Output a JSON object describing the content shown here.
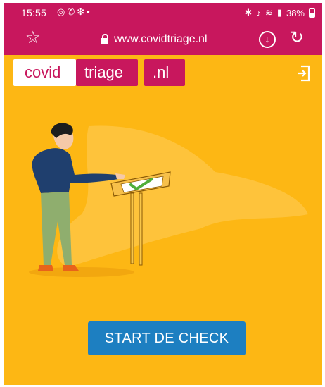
{
  "status_bar": {
    "time": "15:55",
    "left_icons": [
      "instagram-icon",
      "whatsapp-icon",
      "fan-icon",
      "dot-icon"
    ],
    "right_icons": [
      "bluetooth-icon",
      "mute-icon",
      "wifi-icon",
      "signal-icon"
    ],
    "battery": "38%"
  },
  "browser": {
    "url": "www.covidtriage.nl",
    "icons": [
      "star-icon",
      "lock-icon",
      "download-icon",
      "reload-icon"
    ]
  },
  "logo": {
    "part1": "covid",
    "part2": "triage",
    "part3": ".nl"
  },
  "colors": {
    "brand_magenta": "#c8175d",
    "background_yellow": "#fdb714",
    "button_blue": "#1d7fc1"
  },
  "cta": {
    "label": "START DE CHECK"
  }
}
